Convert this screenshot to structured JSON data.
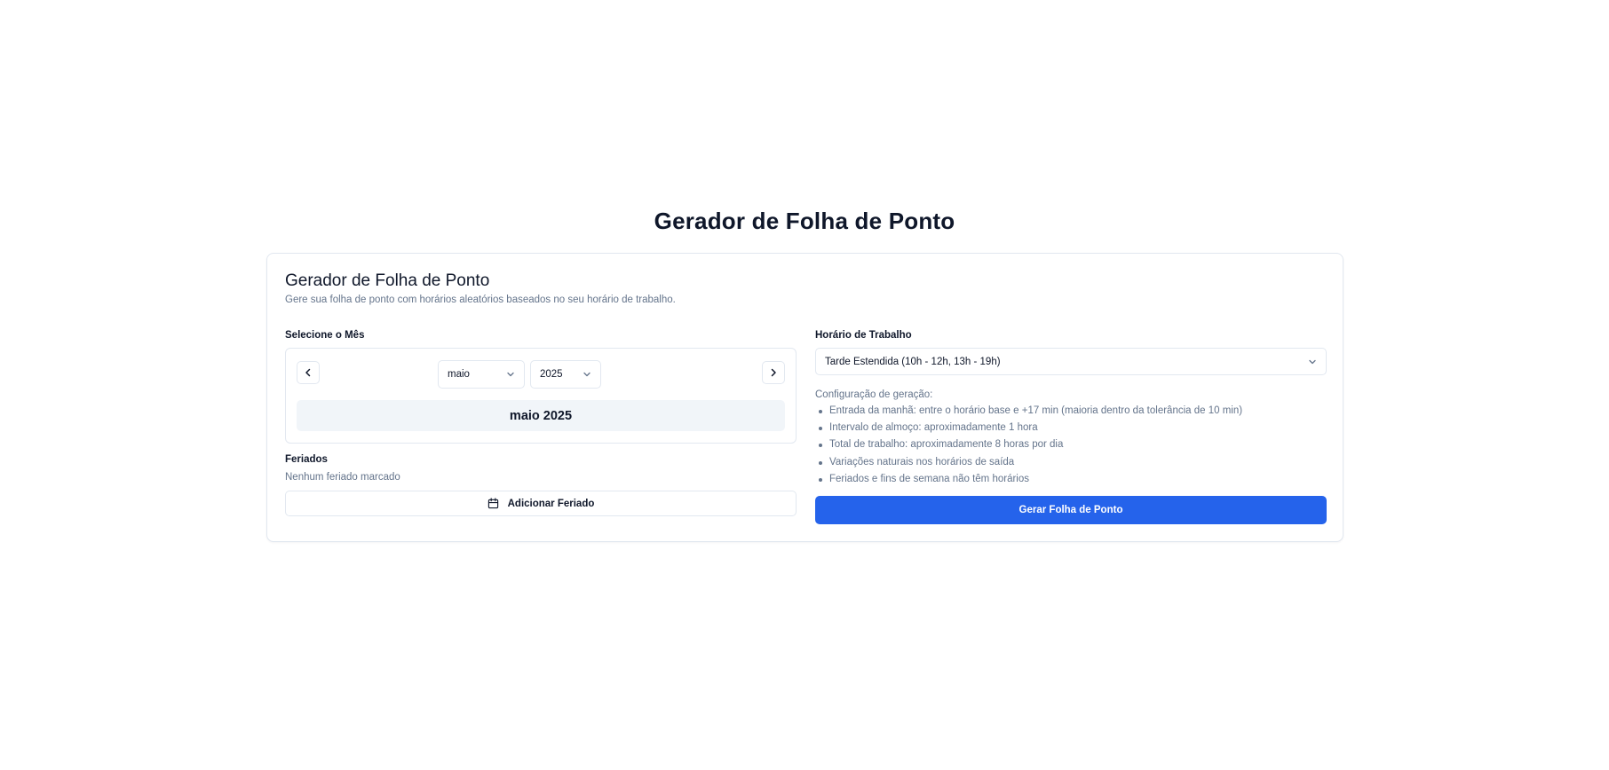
{
  "page": {
    "title": "Gerador de Folha de Ponto"
  },
  "card": {
    "title": "Gerador de Folha de Ponto",
    "description": "Gere sua folha de ponto com horários aleatórios baseados no seu horário de trabalho."
  },
  "month_section": {
    "label": "Selecione o Mês",
    "prev_icon": "chevron-left-icon",
    "next_icon": "chevron-right-icon",
    "month_value": "maio",
    "year_value": "2025",
    "display": "maio 2025"
  },
  "holidays": {
    "label": "Feriados",
    "empty_text": "Nenhum feriado marcado",
    "add_button_label": "Adicionar Feriado",
    "add_button_icon": "calendar-icon"
  },
  "schedule": {
    "label": "Horário de Trabalho",
    "selected": "Tarde Estendida (10h - 12h, 13h - 19h)"
  },
  "config": {
    "title": "Configuração de geração:",
    "items": [
      "Entrada da manhã: entre o horário base e +17 min (maioria dentro da tolerância de 10 min)",
      "Intervalo de almoço: aproximadamente 1 hora",
      "Total de trabalho: aproximadamente 8 horas por dia",
      "Variações naturais nos horários de saída",
      "Feriados e fins de semana não têm horários"
    ]
  },
  "generate_button_label": "Gerar Folha de Ponto",
  "colors": {
    "primary": "#2563eb",
    "border": "#e2e8f0",
    "muted_text": "#64748b",
    "muted_bg": "#f1f5f9"
  }
}
